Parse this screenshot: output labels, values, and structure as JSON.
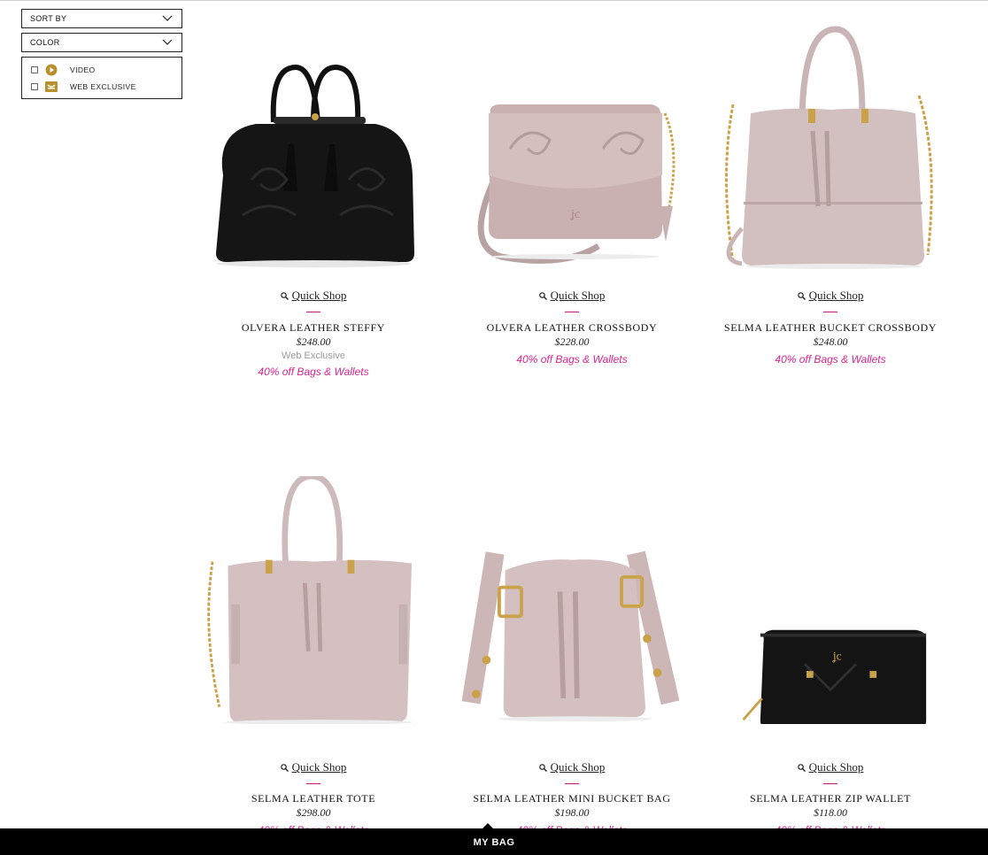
{
  "filters": {
    "sort_label": "SORT BY",
    "color_label": "COLOR",
    "facets": [
      {
        "label": "VIDEO",
        "icon": "play-icon"
      },
      {
        "label": "WEB EXCLUSIVE",
        "icon": "web-exclusive-icon"
      }
    ]
  },
  "quick_shop_label": "Quick Shop",
  "products": [
    {
      "name": "OLVERA LEATHER STEFFY",
      "price": "$248.00",
      "badge": "Web Exclusive",
      "promo": "40% off Bags & Wallets"
    },
    {
      "name": "OLVERA LEATHER CROSSBODY",
      "price": "$228.00",
      "promo": "40% off Bags & Wallets"
    },
    {
      "name": "SELMA LEATHER BUCKET CROSSBODY",
      "price": "$248.00",
      "promo": "40% off Bags & Wallets"
    },
    {
      "name": "SELMA LEATHER TOTE",
      "price": "$298.00",
      "promo": "40% off Bags & Wallets"
    },
    {
      "name": "SELMA LEATHER MINI BUCKET BAG",
      "price": "$198.00",
      "promo": "40% off Bags & Wallets"
    },
    {
      "name": "SELMA LEATHER ZIP WALLET",
      "price": "$118.00",
      "promo": "40% off Bags & Wallets"
    }
  ],
  "bag_bar": {
    "label": "MY BAG"
  },
  "colors": {
    "accent_pink": "#d9238f",
    "gold": "#b8912e",
    "bar": "#000000"
  }
}
